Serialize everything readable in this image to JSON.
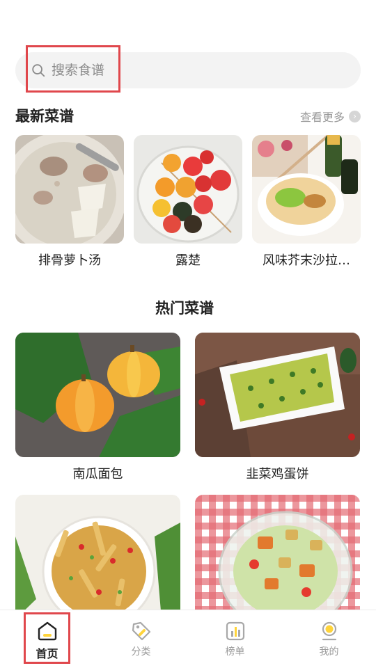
{
  "search": {
    "placeholder": "搜索食谱"
  },
  "latest": {
    "title": "最新菜谱",
    "see_more": "查看更多",
    "items": [
      {
        "name": "排骨萝卜汤"
      },
      {
        "name": "露楚"
      },
      {
        "name": "风味芥末沙拉…"
      }
    ]
  },
  "hot": {
    "title": "热门菜谱",
    "items": [
      {
        "name": "南瓜面包"
      },
      {
        "name": "韭菜鸡蛋饼"
      },
      {
        "name": ""
      },
      {
        "name": ""
      }
    ]
  },
  "tabbar": {
    "items": [
      {
        "label": "首页",
        "icon": "home-icon",
        "active": true
      },
      {
        "label": "分类",
        "icon": "tag-icon",
        "active": false
      },
      {
        "label": "榜单",
        "icon": "chart-icon",
        "active": false
      },
      {
        "label": "我的",
        "icon": "profile-icon",
        "active": false
      }
    ]
  },
  "colors": {
    "accent": "#ffd43b",
    "highlight_box": "#e0474c",
    "tab_active": "#222222",
    "tab_inactive": "#999999"
  }
}
